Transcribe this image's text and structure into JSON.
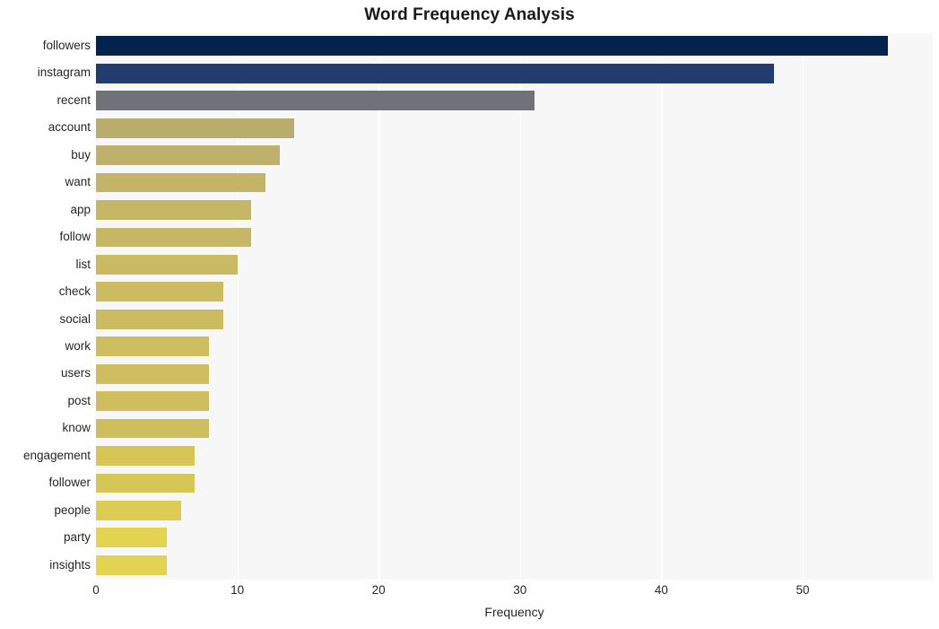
{
  "chart_data": {
    "type": "bar",
    "orientation": "horizontal",
    "title": "Word Frequency Analysis",
    "xlabel": "Frequency",
    "ylabel": "",
    "xlim": [
      0,
      59.2
    ],
    "xticks": [
      0,
      10,
      20,
      30,
      40,
      50
    ],
    "xtick_labels": [
      "0",
      "10",
      "20",
      "30",
      "40",
      "50"
    ],
    "grid": "vertical-white-on-light-gray",
    "legend": "none",
    "categories": [
      "followers",
      "instagram",
      "recent",
      "account",
      "buy",
      "want",
      "app",
      "follow",
      "list",
      "check",
      "social",
      "work",
      "users",
      "post",
      "know",
      "engagement",
      "follower",
      "people",
      "party",
      "insights"
    ],
    "values": [
      56,
      48,
      31,
      14,
      13,
      12,
      11,
      11,
      10,
      9,
      9,
      8,
      8,
      8,
      8,
      7,
      7,
      6,
      5,
      5
    ],
    "bar_colors": [
      "#04234c",
      "#233c6e",
      "#70727a",
      "#b8ad6e",
      "#bfb16b",
      "#c3b468",
      "#c6b766",
      "#c6b766",
      "#c9b963",
      "#ccbc61",
      "#ccbc61",
      "#cfbe5f",
      "#cfbe5f",
      "#cfbe5f",
      "#cfbe5f",
      "#d6c557",
      "#d6c557",
      "#ddcc53",
      "#e4d251",
      "#e4d251"
    ],
    "plot_background": "#f7f7f7",
    "gridline_color": "#ffffff",
    "figure_background": "#ffffff",
    "text_color": "#262626"
  }
}
